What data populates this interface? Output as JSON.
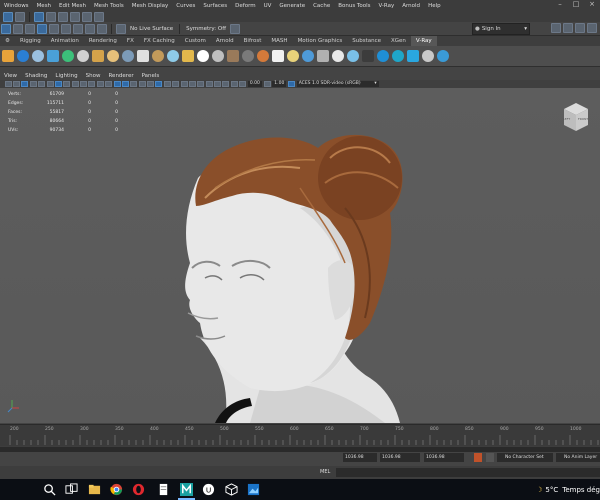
{
  "menubar": {
    "items": [
      "Windows",
      "Mesh",
      "Edit Mesh",
      "Mesh Tools",
      "Mesh Display",
      "Curves",
      "Surfaces",
      "Deform",
      "UV",
      "Generate",
      "Cache",
      "Bonus Tools",
      "V-Ray",
      "Arnold",
      "Help"
    ],
    "window_buttons": [
      "–",
      "□",
      "×"
    ]
  },
  "statusline": {
    "live_surface": "No Live Surface",
    "symmetry": "Symmetry: Off",
    "sign_in": "Sign In"
  },
  "shelf": {
    "tabs": [
      "Rigging",
      "Animation",
      "Rendering",
      "FX",
      "FX Caching",
      "Custom",
      "Arnold",
      "Bifrost",
      "MASH",
      "Motion Graphics",
      "Substance",
      "XGen",
      "V-Ray"
    ],
    "active_tab": "V-Ray"
  },
  "panel": {
    "menu": [
      "View",
      "Shading",
      "Lighting",
      "Show",
      "Renderer",
      "Panels"
    ],
    "exposure": "0.00",
    "gamma": "1.00",
    "color_space": "ACES 1.0 SDR-video (sRGB)"
  },
  "hud": {
    "rows": [
      {
        "label": "Verts:",
        "value": "61709",
        "a": "0",
        "b": "0"
      },
      {
        "label": "Edges:",
        "value": "115711",
        "a": "0",
        "b": "0"
      },
      {
        "label": "Faces:",
        "value": "55817",
        "a": "0",
        "b": "0"
      },
      {
        "label": "Tris:",
        "value": "80664",
        "a": "0",
        "b": "0"
      },
      {
        "label": "UVs:",
        "value": "90734",
        "a": "0",
        "b": "0"
      }
    ]
  },
  "viewcube": {
    "left": "LEFT",
    "front": "FRONT"
  },
  "timeslider": {
    "ticks": [
      "200",
      "250",
      "300",
      "350",
      "400",
      "450",
      "500",
      "550",
      "600",
      "650",
      "700",
      "750",
      "800",
      "850",
      "900",
      "950",
      "1000"
    ]
  },
  "bottombar": {
    "start_value": "1036.98",
    "current_value": "1036.98",
    "end_value": "1036.98",
    "character_set": "No Character Set",
    "anim_layer": "No Anim Layer"
  },
  "melbar": {
    "label": "MEL"
  },
  "taskbar": {
    "weather_temp": "5°C",
    "weather_text": "Temps dég"
  },
  "colors": {
    "accent": "#3a6a9c",
    "ui_bg": "#444444",
    "viewport_bg": "#5b5b5b",
    "hair": "#8a4f2a",
    "skin": "#e6e6e6"
  }
}
